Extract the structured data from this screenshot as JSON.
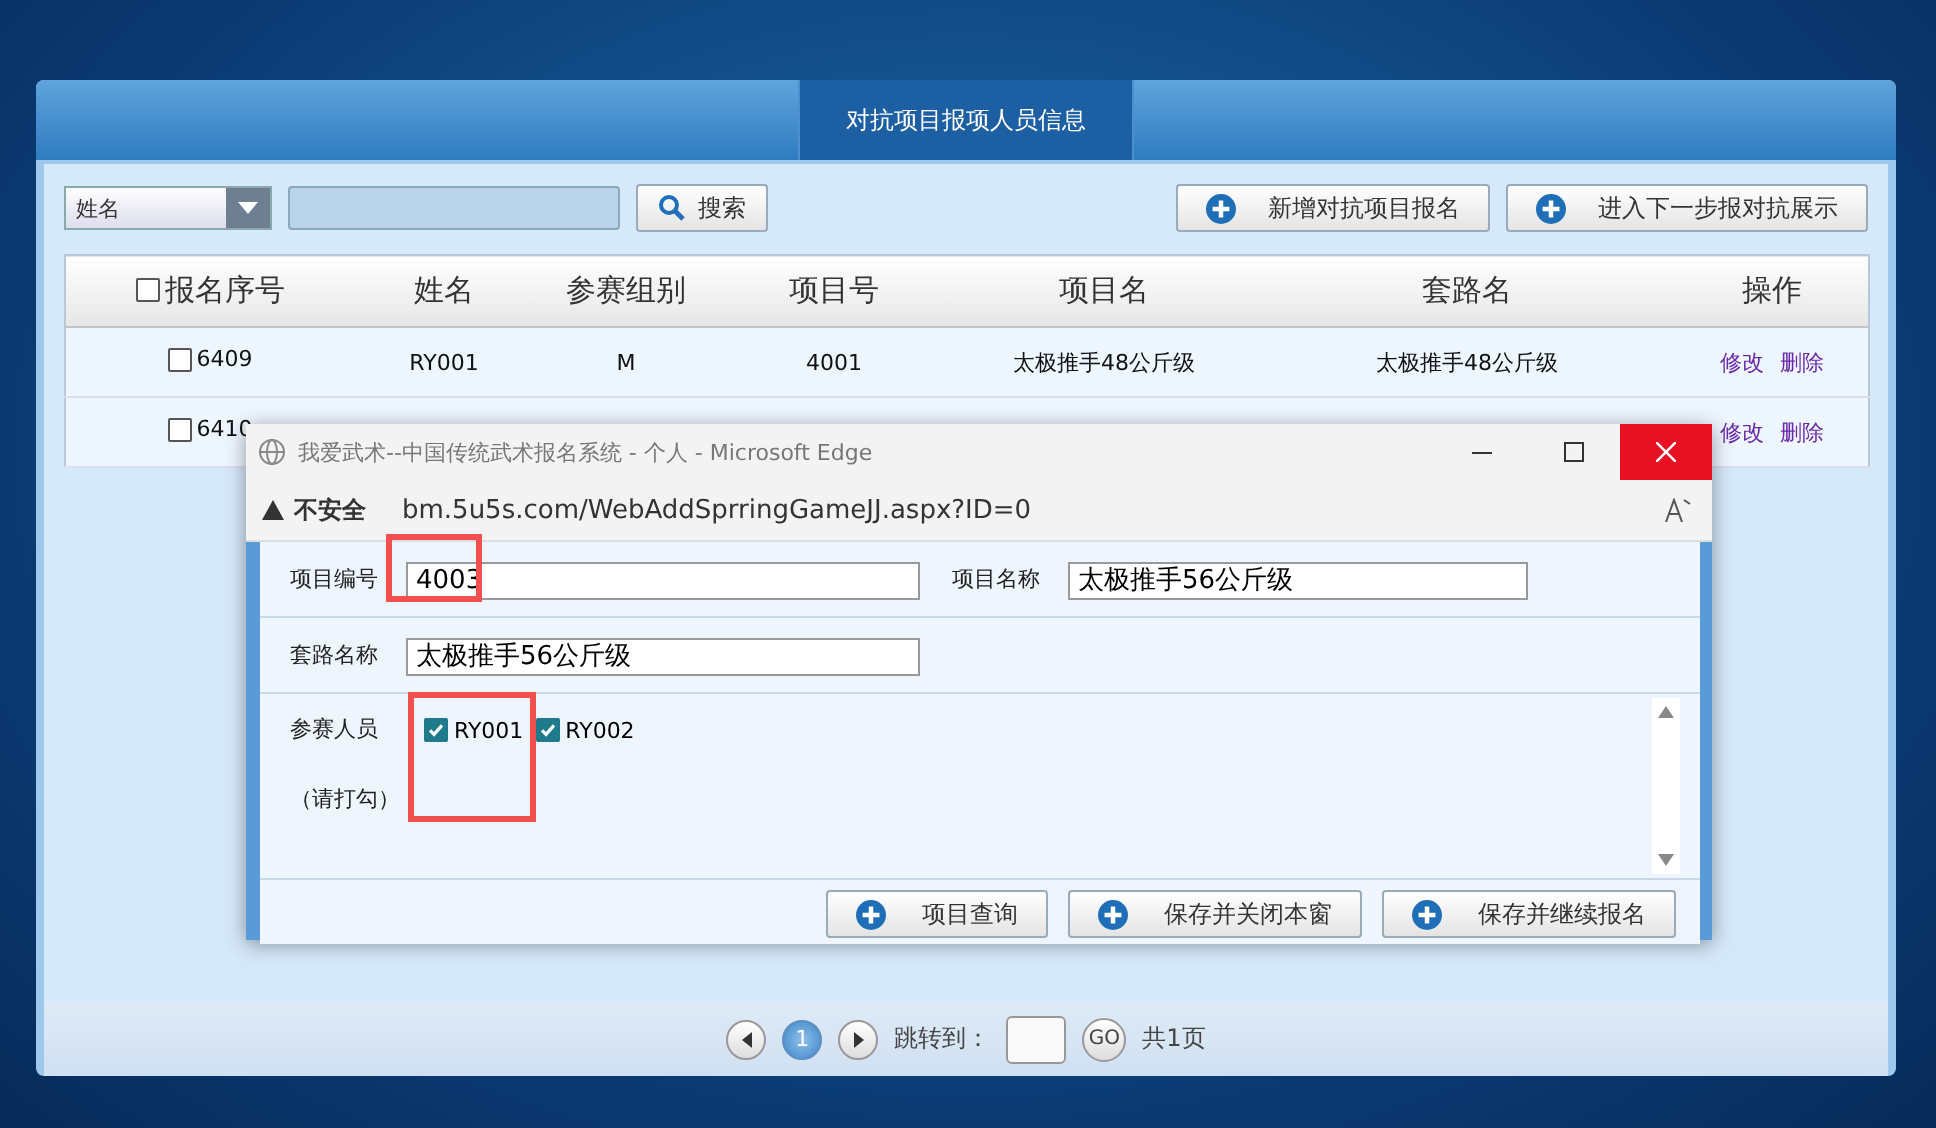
{
  "page": {
    "title": "对抗项目报项人员信息"
  },
  "toolbar": {
    "filter_select": "姓名",
    "search_button": "搜索",
    "buttons": [
      "新增对抗项目报名",
      "进入下一步报对抗展示"
    ]
  },
  "table": {
    "select_all_checked": false,
    "columns": [
      "报名序号",
      "姓名",
      "参赛组别",
      "项目号",
      "项目名",
      "套路名",
      "操作"
    ],
    "rows": [
      {
        "checked": false,
        "cells": [
          "6409",
          "RY001",
          "M",
          "4001",
          "太极推手48公斤级",
          "太极推手48公斤级"
        ],
        "actions": [
          "修改",
          "删除"
        ]
      },
      {
        "checked": false,
        "cells": [
          "6410"
        ],
        "actions": [
          "修改",
          "删除"
        ]
      }
    ]
  },
  "pagination": {
    "pages": [
      {
        "label": "1",
        "selected": true
      }
    ],
    "jump_label": "跳转到：",
    "go": "GO",
    "total": "共1页"
  },
  "popup": {
    "title": "我爱武术--中国传统武术报名系统 - 个人 - Microsoft Edge",
    "security": "不安全",
    "url": "bm.5u5s.com/WebAddSprringGameJJ.aspx?ID=0",
    "field_rows": [
      [
        {
          "label": "项目编号",
          "value": "4003",
          "highlighted": true
        },
        {
          "label": "项目名称",
          "value": "太极推手56公斤级",
          "highlighted": false
        }
      ],
      [
        {
          "label": "套路名称",
          "value": "太极推手56公斤级",
          "highlighted": false
        }
      ]
    ],
    "participants": {
      "label": "参赛人员",
      "hint": "（请打勾）",
      "options": [
        {
          "name": "RY001",
          "checked": true,
          "highlighted": true
        },
        {
          "name": "RY002",
          "checked": true,
          "highlighted": false
        }
      ]
    },
    "buttons": [
      "项目查询",
      "保存并关闭本窗",
      "保存并继续报名"
    ]
  }
}
